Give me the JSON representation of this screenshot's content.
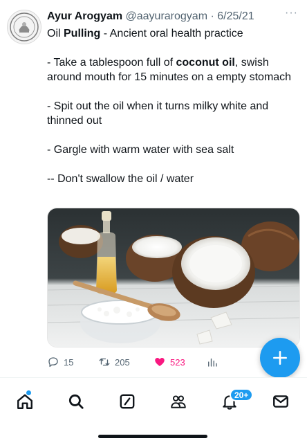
{
  "tweet": {
    "name": "Ayur Arogyam",
    "handle": "@aayurarogyam",
    "separator": "·",
    "date": "6/25/21",
    "more_glyph": "···",
    "title_pre": "Oil ",
    "title_bold": "Pulling",
    "title_post": " - Ancient  oral health practice",
    "step1_pre": "- Take a tablespoon full of ",
    "step1_bold": "coconut oil",
    "step1_post": ", swish around mouth for 15 minutes on a empty stomach",
    "step2": "- Spit out the oil when it turns milky white and thinned out",
    "step3": "- Gargle with warm water with sea salt",
    "step4": "-- Don't swallow the oil / water"
  },
  "actions": {
    "replies": "15",
    "retweets": "205",
    "likes": "523"
  },
  "colors": {
    "accent": "#1d9bf0",
    "like": "#f91880",
    "muted": "#536471"
  },
  "nav": {
    "notifications_badge": "20+"
  }
}
